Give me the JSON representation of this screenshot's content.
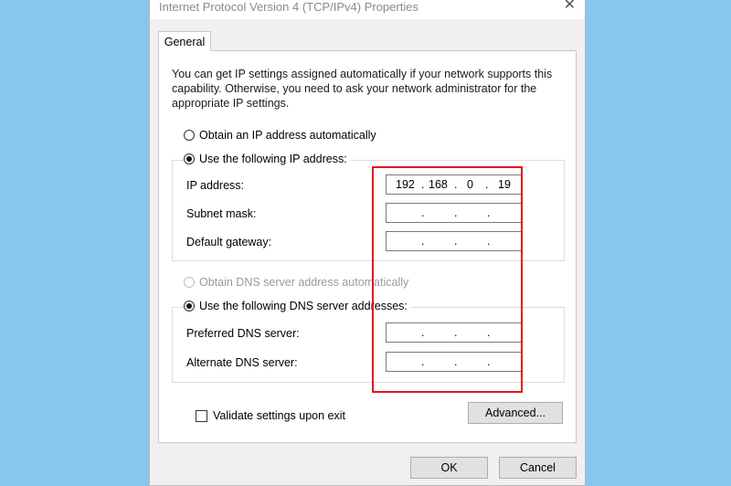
{
  "window": {
    "title": "Internet Protocol Version 4 (TCP/IPv4) Properties",
    "close_glyph": "✕"
  },
  "tabs": [
    "General"
  ],
  "description": "You can get IP settings assigned automatically if your network supports this capability. Otherwise, you need to ask your network administrator for the appropriate IP settings.",
  "ip_section": {
    "auto_label": "Obtain an IP address automatically",
    "manual_label": "Use the following IP address:",
    "selected": "manual",
    "fields": [
      {
        "label": "IP address:",
        "octets": [
          "192",
          "168",
          "0",
          "19"
        ]
      },
      {
        "label": "Subnet mask:",
        "octets": [
          "",
          "",
          "",
          ""
        ]
      },
      {
        "label": "Default gateway:",
        "octets": [
          "",
          "",
          "",
          ""
        ]
      }
    ]
  },
  "dns_section": {
    "auto_label": "Obtain DNS server address automatically",
    "manual_label": "Use the following DNS server addresses:",
    "selected": "manual",
    "fields": [
      {
        "label": "Preferred DNS server:",
        "octets": [
          "",
          "",
          "",
          ""
        ]
      },
      {
        "label": "Alternate DNS server:",
        "octets": [
          "",
          "",
          "",
          ""
        ]
      }
    ]
  },
  "validate_label": "Validate settings upon exit",
  "validate_checked": false,
  "buttons": {
    "advanced": "Advanced...",
    "ok": "OK",
    "cancel": "Cancel"
  },
  "highlight_color": "#e3141f"
}
